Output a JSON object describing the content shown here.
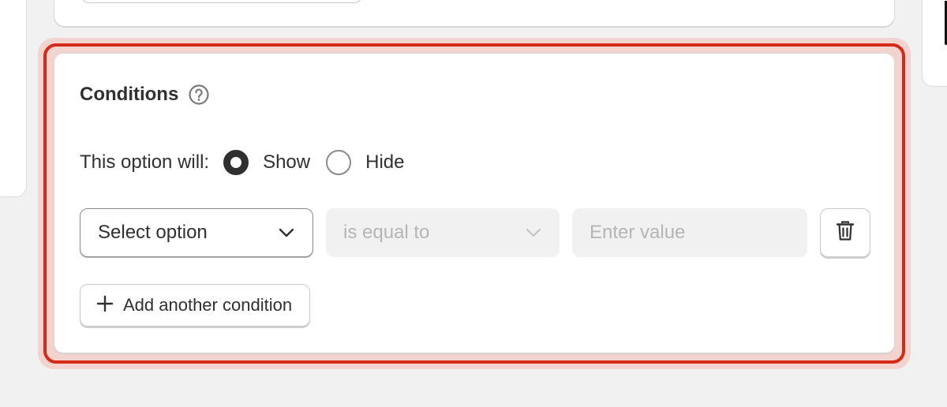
{
  "conditions": {
    "title": "Conditions",
    "visibility": {
      "label": "This option will:",
      "options": [
        {
          "label": "Show",
          "checked": true
        },
        {
          "label": "Hide",
          "checked": false
        }
      ]
    },
    "row": {
      "select_value": "Select option",
      "operator_value": "is equal to",
      "value_placeholder": "Enter value"
    },
    "add_button_label": "Add another condition"
  },
  "icons": {
    "help": "question-circle-icon",
    "select_chevron": "chevron-down-icon",
    "operator_chevron": "chevron-down-icon",
    "delete": "trash-icon",
    "add": "plus-icon"
  },
  "colors": {
    "highlight_border": "#d52a18",
    "highlight_halo": "#f3d3cd",
    "text": "#303030",
    "disabled_text": "#b5b5b5",
    "page_background": "#f1f1f1"
  }
}
